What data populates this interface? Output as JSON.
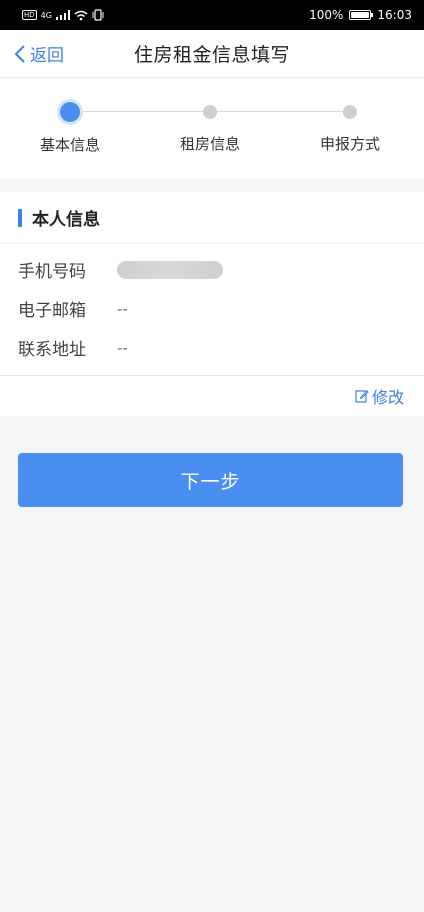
{
  "status_bar": {
    "signal_badge": "HD",
    "network": "4G",
    "battery_percent": "100%",
    "battery_level": 1.0,
    "time": "16:03"
  },
  "nav": {
    "back_label": "返回",
    "title": "住房租金信息填写"
  },
  "steps": [
    {
      "label": "基本信息",
      "active": true
    },
    {
      "label": "租房信息",
      "active": false
    },
    {
      "label": "申报方式",
      "active": false
    }
  ],
  "personal_info": {
    "title": "本人信息",
    "rows": [
      {
        "label": "手机号码",
        "value": ""
      },
      {
        "label": "电子邮箱",
        "value": "--"
      },
      {
        "label": "联系地址",
        "value": "--"
      }
    ]
  },
  "edit_label": "修改",
  "next_label": "下一步",
  "colors": {
    "accent": "#4a8ff0",
    "link": "#3d7fe6",
    "background": "#f5f6f8"
  }
}
